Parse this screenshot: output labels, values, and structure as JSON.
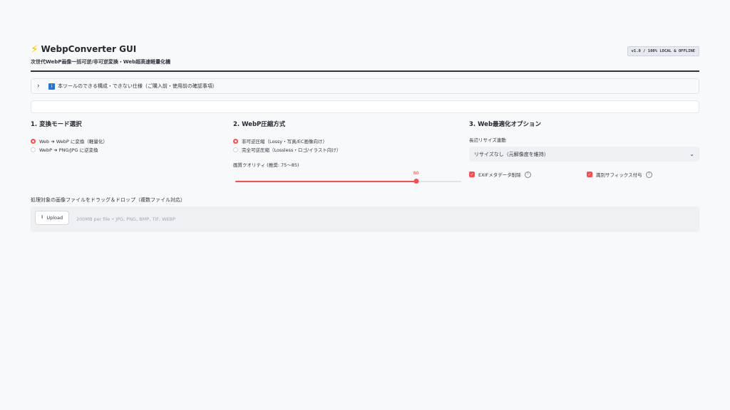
{
  "header": {
    "icon": "lightning-icon",
    "title": "WebpConverter GUI",
    "subtitle": "次世代WebP画像一括可逆/非可逆変換・Web超高速軽量化機",
    "version_badge": "v1.0 / 100% LOCAL & OFFLINE"
  },
  "expander": {
    "chevron": "›",
    "info_icon": "i",
    "label": "本ツールのできる構成・できない仕様（ご購入前・使用前の確認事項）"
  },
  "mode": {
    "heading": "1. 変換モード選択",
    "options": [
      "Web ➔ WebP に変換（軽量化）",
      "WebP ➔ PNG/JPG に逆変換"
    ],
    "selected_index": 0
  },
  "compression": {
    "heading": "2. WebP圧縮方式",
    "options": [
      "非可逆圧縮（Lossy・写真/EC画像向け）",
      "完全可逆圧縮（Lossless・ロゴ/イラスト向け）"
    ],
    "selected_index": 0,
    "quality_label": "画質クオリティ (推奨: 75〜85)",
    "quality_value": "80",
    "quality_min": 0,
    "quality_max": 100
  },
  "options": {
    "heading": "3. Web最適化オプション",
    "resize_label": "長辺リサイズ連動",
    "resize_value": "リサイズなし（元解像度を維持）",
    "exif_label": "EXIFメタデータ削除",
    "exif_checked": true,
    "suffix_label": "識別サフィックス付与",
    "suffix_checked": true
  },
  "uploader": {
    "label": "処理対象の画像ファイルをドラッグ＆ドロップ（複数ファイル対応）",
    "button_label": "Upload",
    "hint": "200MB per file • JPG, PNG, BMP, TIF, WEBP"
  },
  "colors": {
    "accent": "#ff4b4b",
    "background": "#f8f9fb",
    "text": "#31333f"
  }
}
